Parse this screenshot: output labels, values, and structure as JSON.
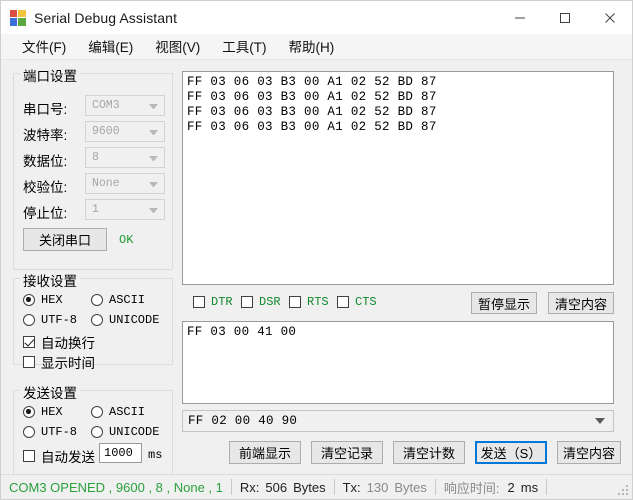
{
  "window": {
    "title": "Serial Debug Assistant",
    "icon": "app-grid-icon",
    "minimize": "minimize-icon",
    "maximize": "maximize-icon",
    "close": "close-icon"
  },
  "menubar": {
    "items": [
      {
        "label": "文件(F)"
      },
      {
        "label": "编辑(E)"
      },
      {
        "label": "视图(V)"
      },
      {
        "label": "工具(T)"
      },
      {
        "label": "帮助(H)"
      }
    ]
  },
  "port_settings": {
    "legend": "端口设置",
    "fields": [
      {
        "label": "串口号:",
        "value": "COM3"
      },
      {
        "label": "波特率:",
        "value": "9600"
      },
      {
        "label": "数据位:",
        "value": "8"
      },
      {
        "label": "校验位:",
        "value": "None"
      },
      {
        "label": "停止位:",
        "value": "1"
      }
    ],
    "close_port_button": "关闭串口",
    "status_ok": "OK"
  },
  "receive_settings": {
    "legend": "接收设置",
    "encodings": [
      {
        "label": "HEX",
        "selected": true
      },
      {
        "label": "ASCII",
        "selected": false
      },
      {
        "label": "UTF-8",
        "selected": false
      },
      {
        "label": "UNICODE",
        "selected": false
      }
    ],
    "auto_wrap": {
      "label": "自动换行",
      "checked": true
    },
    "show_time": {
      "label": "显示时间",
      "checked": false
    }
  },
  "send_settings": {
    "legend": "发送设置",
    "encodings": [
      {
        "label": "HEX",
        "selected": true
      },
      {
        "label": "ASCII",
        "selected": false
      },
      {
        "label": "UTF-8",
        "selected": false
      },
      {
        "label": "UNICODE",
        "selected": false
      }
    ],
    "auto_send": {
      "label": "自动发送",
      "checked": false,
      "interval": "1000",
      "unit": "ms"
    }
  },
  "receive_area": {
    "lines": [
      "FF 03 06 03 B3 00 A1 02 52 BD 87",
      "FF 03 06 03 B3 00 A1 02 52 BD 87",
      "FF 03 06 03 B3 00 A1 02 52 BD 87",
      "FF 03 06 03 B3 00 A1 02 52 BD 87"
    ]
  },
  "signal_flags": [
    {
      "label": "DTR",
      "checked": false
    },
    {
      "label": "DSR",
      "checked": false
    },
    {
      "label": "RTS",
      "checked": false
    },
    {
      "label": "CTS",
      "checked": false
    }
  ],
  "receive_toolbar": {
    "pause_display": "暂停显示",
    "clear_content": "清空内容"
  },
  "send_area": {
    "lines": [
      "FF 03 00 41 00"
    ],
    "history_value": "FF 02 00 40 90",
    "history_arrow": "chevron-down-icon"
  },
  "send_toolbar": {
    "buttons": [
      {
        "label": "前端显示",
        "focused": false
      },
      {
        "label": "清空记录",
        "focused": false
      },
      {
        "label": "清空计数",
        "focused": false
      },
      {
        "label": "发送（S）",
        "focused": true
      },
      {
        "label": "清空内容",
        "focused": false
      }
    ]
  },
  "statusbar": {
    "connection": "COM3 OPENED , 9600 , 8 , None , 1",
    "rx_label": "Rx:",
    "rx_value": "506",
    "rx_unit": "Bytes",
    "tx_label": "Tx:",
    "tx_value": "130",
    "tx_unit": "Bytes",
    "latency_label": "响应时间:",
    "latency_value": "2",
    "latency_unit": "ms"
  },
  "colors": {
    "status_green": "#2aa13c",
    "ok_green": "#1f9b34",
    "flag_green": "#12892b",
    "focus_blue": "#0078d7"
  }
}
